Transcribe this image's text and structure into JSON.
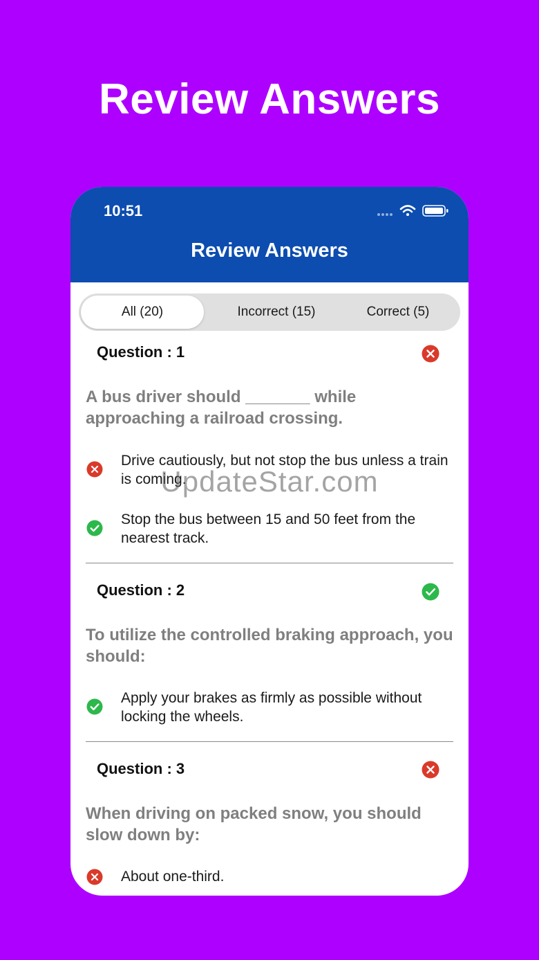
{
  "hero": {
    "title": "Review Answers"
  },
  "status_bar": {
    "time": "10:51"
  },
  "header": {
    "title": "Review Answers"
  },
  "tabs": [
    {
      "label": "All (20)",
      "selected": true
    },
    {
      "label": "Incorrect (15)",
      "selected": false
    },
    {
      "label": "Correct (5)",
      "selected": false
    }
  ],
  "questions": [
    {
      "label": "Question : 1",
      "status": "incorrect",
      "text": "A bus driver should _______ while approaching a railroad crossing.",
      "answers": [
        {
          "status": "incorrect",
          "text": "Drive cautiously, but not stop the bus unless a train is coming."
        },
        {
          "status": "correct",
          "text": "Stop the bus between 15 and 50 feet from the nearest track."
        }
      ]
    },
    {
      "label": "Question : 2",
      "status": "correct",
      "text": "To utilize the controlled braking approach, you should:",
      "answers": [
        {
          "status": "correct",
          "text": "Apply your brakes as firmly as possible without locking the wheels."
        }
      ]
    },
    {
      "label": "Question : 3",
      "status": "incorrect",
      "text": "When driving on packed snow, you should slow down by:",
      "answers": [
        {
          "status": "incorrect",
          "text": "About one-third."
        }
      ]
    }
  ],
  "watermark": "UpdateStar.com",
  "colors": {
    "background": "#AD00FF",
    "header": "#0C4DAF",
    "correct": "#2DB84B",
    "incorrect": "#D93A2B"
  },
  "icons": {
    "correct": "check-circle-icon",
    "incorrect": "x-circle-icon",
    "wifi": "wifi-icon",
    "battery": "battery-icon",
    "signal": "signal-dots-icon"
  }
}
